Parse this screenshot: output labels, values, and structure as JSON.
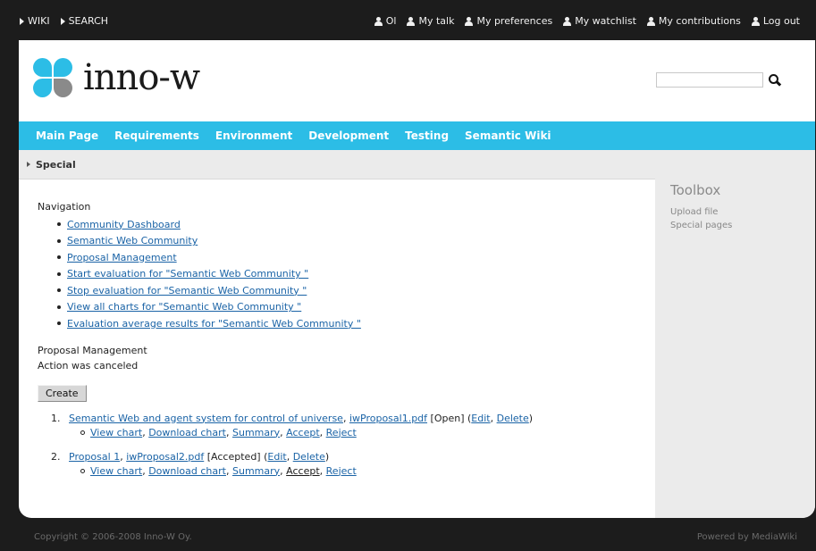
{
  "topbar": {
    "left": [
      "WIKI",
      "SEARCH"
    ],
    "right": [
      "Ol",
      "My talk",
      "My preferences",
      "My watchlist",
      "My contributions",
      "Log out"
    ]
  },
  "logo": {
    "text": "inno-w"
  },
  "search": {
    "value": "",
    "placeholder": ""
  },
  "nav": [
    "Main Page",
    "Requirements",
    "Environment",
    "Development",
    "Testing",
    "Semantic Wiki"
  ],
  "breadcrumb": "Special",
  "toolbox": {
    "title": "Toolbox",
    "links": [
      "Upload file",
      "Special pages"
    ]
  },
  "content": {
    "nav_title": "Navigation",
    "nav_links": [
      "Community Dashboard",
      "Semantic Web Community",
      "Proposal Management",
      "Start evaluation for \"Semantic Web Community \"",
      "Stop evaluation for \"Semantic Web Community \"",
      "View all charts for \"Semantic Web Community \"",
      "Evaluation average results for \"Semantic Web Community \""
    ],
    "section_title": "Proposal Management",
    "status": "Action was canceled",
    "create_label": "Create",
    "proposals": [
      {
        "num": "1.",
        "title": "Semantic Web and agent system for control of universe",
        "file": "iwProposal1.pdf",
        "state": "[Open]",
        "edit": "Edit",
        "delete": "Delete",
        "actions": [
          "View chart",
          "Download chart",
          "Summary",
          "Accept",
          "Reject"
        ]
      },
      {
        "num": "2.",
        "title": "Proposal 1",
        "file": "iwProposal2.pdf",
        "state": "[Accepted]",
        "edit": "Edit",
        "delete": "Delete",
        "actions": [
          "View chart",
          "Download chart",
          "Summary",
          "Accept",
          "Reject"
        ]
      }
    ]
  },
  "footer": {
    "copyright": "Copyright © 2006-2008 Inno-W Oy.",
    "powered": "Powered by MediaWiki"
  },
  "colors": {
    "accent": "#2cbde6",
    "link": "#1a63a6",
    "background": "#1c1c1c"
  }
}
